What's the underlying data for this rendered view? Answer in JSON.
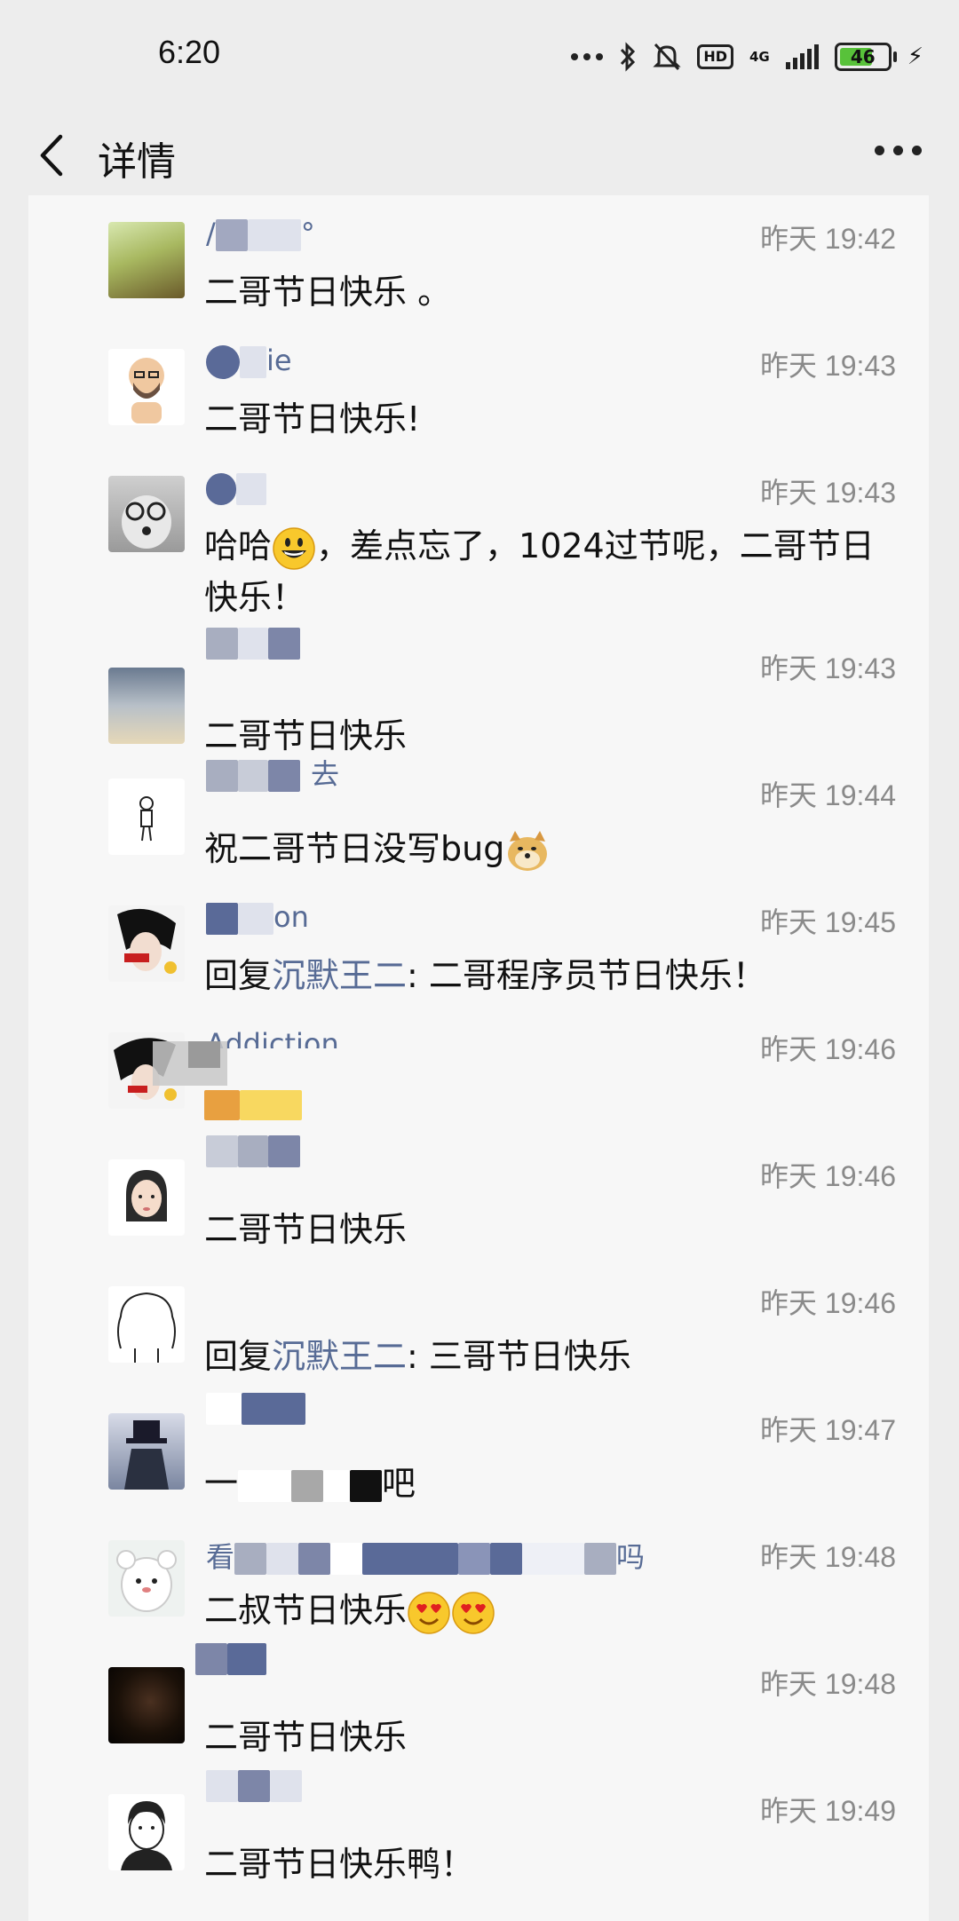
{
  "status_bar": {
    "time": "6:20",
    "network": "4G",
    "hd": "HD",
    "battery": "46"
  },
  "header": {
    "title": "详情"
  },
  "comments": [
    {
      "name": "/",
      "time": "昨天 19:42",
      "text": "二哥节日快乐 。"
    },
    {
      "name": "ie",
      "time": "昨天 19:43",
      "text": "二哥节日快乐!"
    },
    {
      "name": "",
      "time": "昨天 19:43",
      "text_a": "哈哈",
      "text_b": "，差点忘了，1024过节呢，二哥节日快乐！"
    },
    {
      "name": "",
      "time": "昨天 19:43",
      "text": "二哥节日快乐"
    },
    {
      "name": "去",
      "time": "昨天 19:44",
      "text": "祝二哥节日没写bug"
    },
    {
      "name": "on",
      "time": "昨天 19:45",
      "reply_prefix": "回复",
      "reply_to": "沉默王二",
      "text": ": 二哥程序员节日快乐！"
    },
    {
      "name": "Addiction",
      "time": "昨天 19:46",
      "text": ""
    },
    {
      "name": "",
      "time": "昨天 19:46",
      "text": "二哥节日快乐"
    },
    {
      "name": "",
      "time": "昨天 19:46",
      "reply_prefix": "回复",
      "reply_to": "沉默王二",
      "text": ": 三哥节日快乐"
    },
    {
      "name": "",
      "time": "昨天 19:47",
      "text": "吧"
    },
    {
      "name": "看",
      "name_tail": "吗",
      "time": "昨天 19:48",
      "text": "二叔节日快乐"
    },
    {
      "name": "",
      "time": "昨天 19:48",
      "text": "二哥节日快乐"
    },
    {
      "name": "",
      "time": "昨天 19:49",
      "text": "二哥节日快乐鸭！"
    }
  ]
}
